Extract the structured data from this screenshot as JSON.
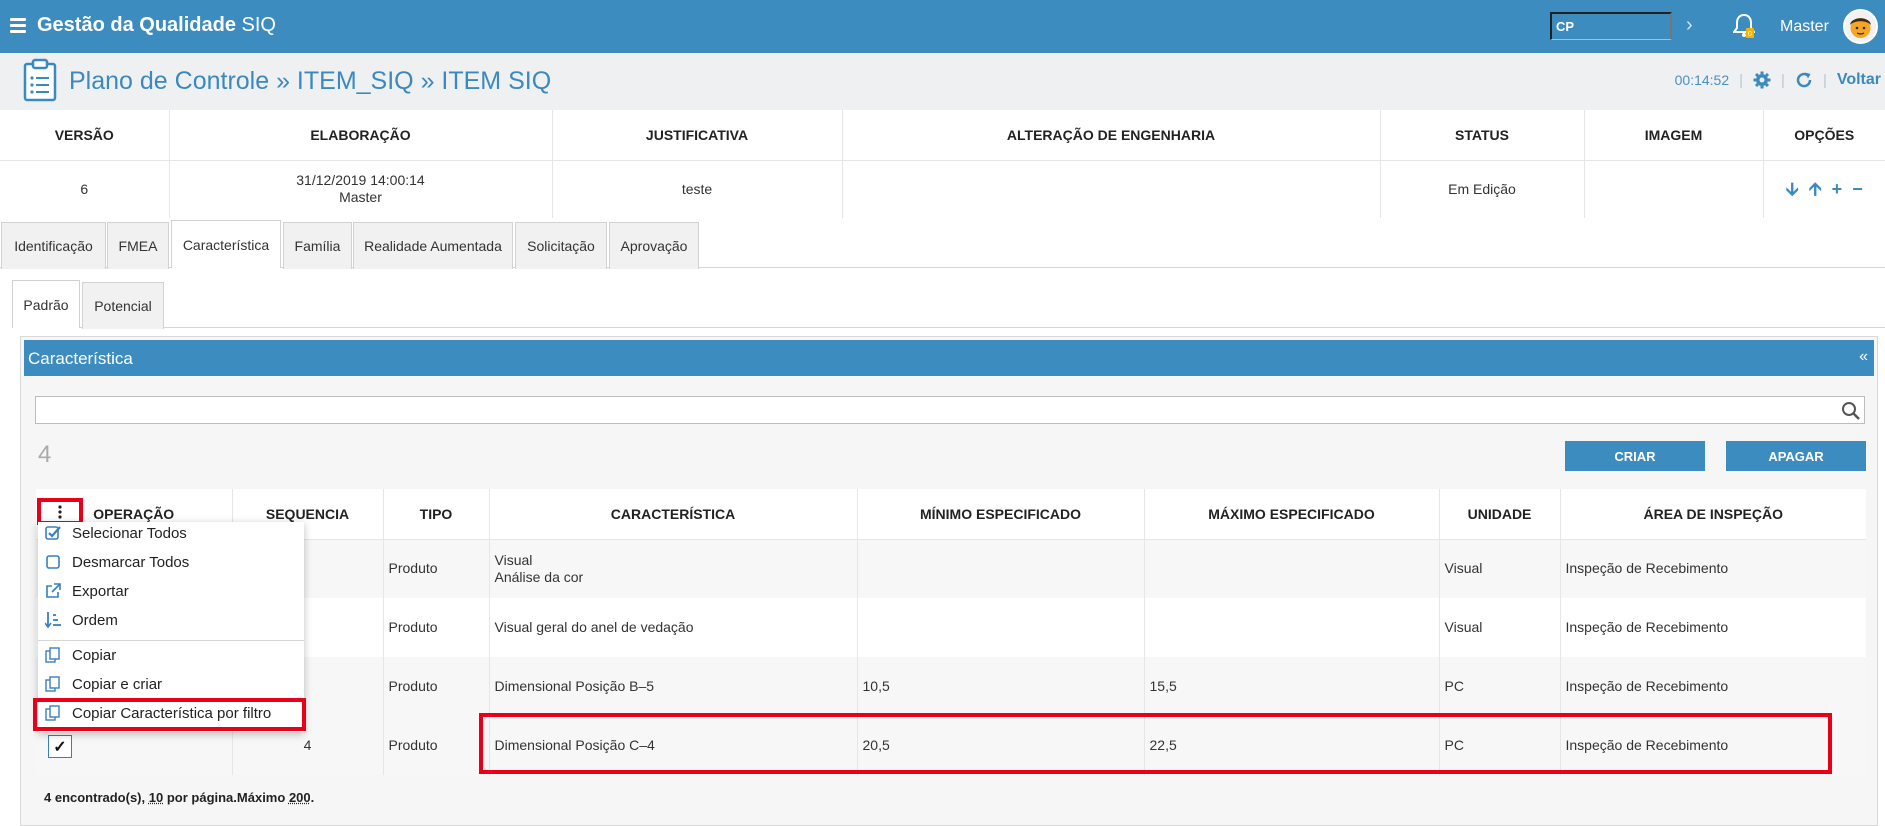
{
  "app": {
    "title_bold": "Gestão da Qualidade",
    "title_rest": "SIQ",
    "user": "Master"
  },
  "topbar": {
    "module_value": "CP"
  },
  "header": {
    "title": "Plano de Controle » ITEM_SIQ » ITEM SIQ",
    "timer": "00:14:52",
    "back_label": "Voltar"
  },
  "version_table": {
    "headers": [
      "VERSÃO",
      "ELABORAÇÃO",
      "JUSTIFICATIVA",
      "ALTERAÇÃO DE ENGENHARIA",
      "STATUS",
      "IMAGEM",
      "OPÇÕES"
    ],
    "row": {
      "versao": "6",
      "elaboracao_date": "31/12/2019 14:00:14",
      "elaboracao_user": "Master",
      "justificativa": "teste",
      "alteracao": "",
      "status": "Em Edição",
      "imagem": ""
    }
  },
  "tabs": [
    "Identificação",
    "FMEA",
    "Característica",
    "Família",
    "Realidade Aumentada",
    "Solicitação",
    "Aprovação"
  ],
  "active_tab": "Característica",
  "subtabs": [
    "Padrão",
    "Potencial"
  ],
  "active_subtab": "Padrão",
  "panel": {
    "title": "Característica",
    "collapse": "«",
    "count": "4",
    "create_label": "CRIAR",
    "delete_label": "APAGAR",
    "search_value": ""
  },
  "grid": {
    "headers": [
      "OPERAÇÃO",
      "SEQUENCIA",
      "TIPO",
      "CARACTERÍSTICA",
      "MÍNIMO ESPECIFICADO",
      "MÁXIMO ESPECIFICADO",
      "UNIDADE",
      "ÁREA DE INSPEÇÃO"
    ],
    "rows": [
      {
        "sequencia": "",
        "tipo": "Produto",
        "caracteristica_l1": "Visual",
        "caracteristica_l2": "Análise da cor",
        "minimo": "",
        "maximo": "",
        "unidade": "Visual",
        "area": "Inspeção de Recebimento"
      },
      {
        "sequencia": "",
        "tipo": "Produto",
        "caracteristica_l1": "Visual geral do anel de vedação",
        "caracteristica_l2": "",
        "minimo": "",
        "maximo": "",
        "unidade": "Visual",
        "area": "Inspeção de Recebimento"
      },
      {
        "sequencia": "",
        "tipo": "Produto",
        "caracteristica_l1": "Dimensional Posição B–5",
        "caracteristica_l2": "",
        "minimo": "10,5",
        "maximo": "15,5",
        "unidade": "PC",
        "area": "Inspeção de Recebimento"
      },
      {
        "sequencia": "4",
        "tipo": "Produto",
        "caracteristica_l1": "Dimensional Posição C–4",
        "caracteristica_l2": "",
        "minimo": "20,5",
        "maximo": "22,5",
        "unidade": "PC",
        "area": "Inspeção de Recebimento"
      }
    ],
    "footer": {
      "found": "4 encontrado(s),",
      "per_page_num": "10",
      "per_page_text": "por página.Máximo",
      "max_num": "200",
      "end": "."
    }
  },
  "context_menu": {
    "items": [
      {
        "label": "Selecionar Todos",
        "icon": "checkbox-checked-icon"
      },
      {
        "label": "Desmarcar Todos",
        "icon": "checkbox-empty-icon"
      },
      {
        "label": "Exportar",
        "icon": "external-link-icon"
      },
      {
        "label": "Ordem",
        "icon": "sort-icon"
      },
      {
        "label": "Copiar",
        "icon": "copy-icon"
      },
      {
        "label": "Copiar e criar",
        "icon": "copy-icon"
      },
      {
        "label": "Copiar Característica por filtro",
        "icon": "copy-icon"
      }
    ]
  },
  "colors": {
    "brand": "#3d8cc0",
    "highlight": "#e8001a"
  }
}
